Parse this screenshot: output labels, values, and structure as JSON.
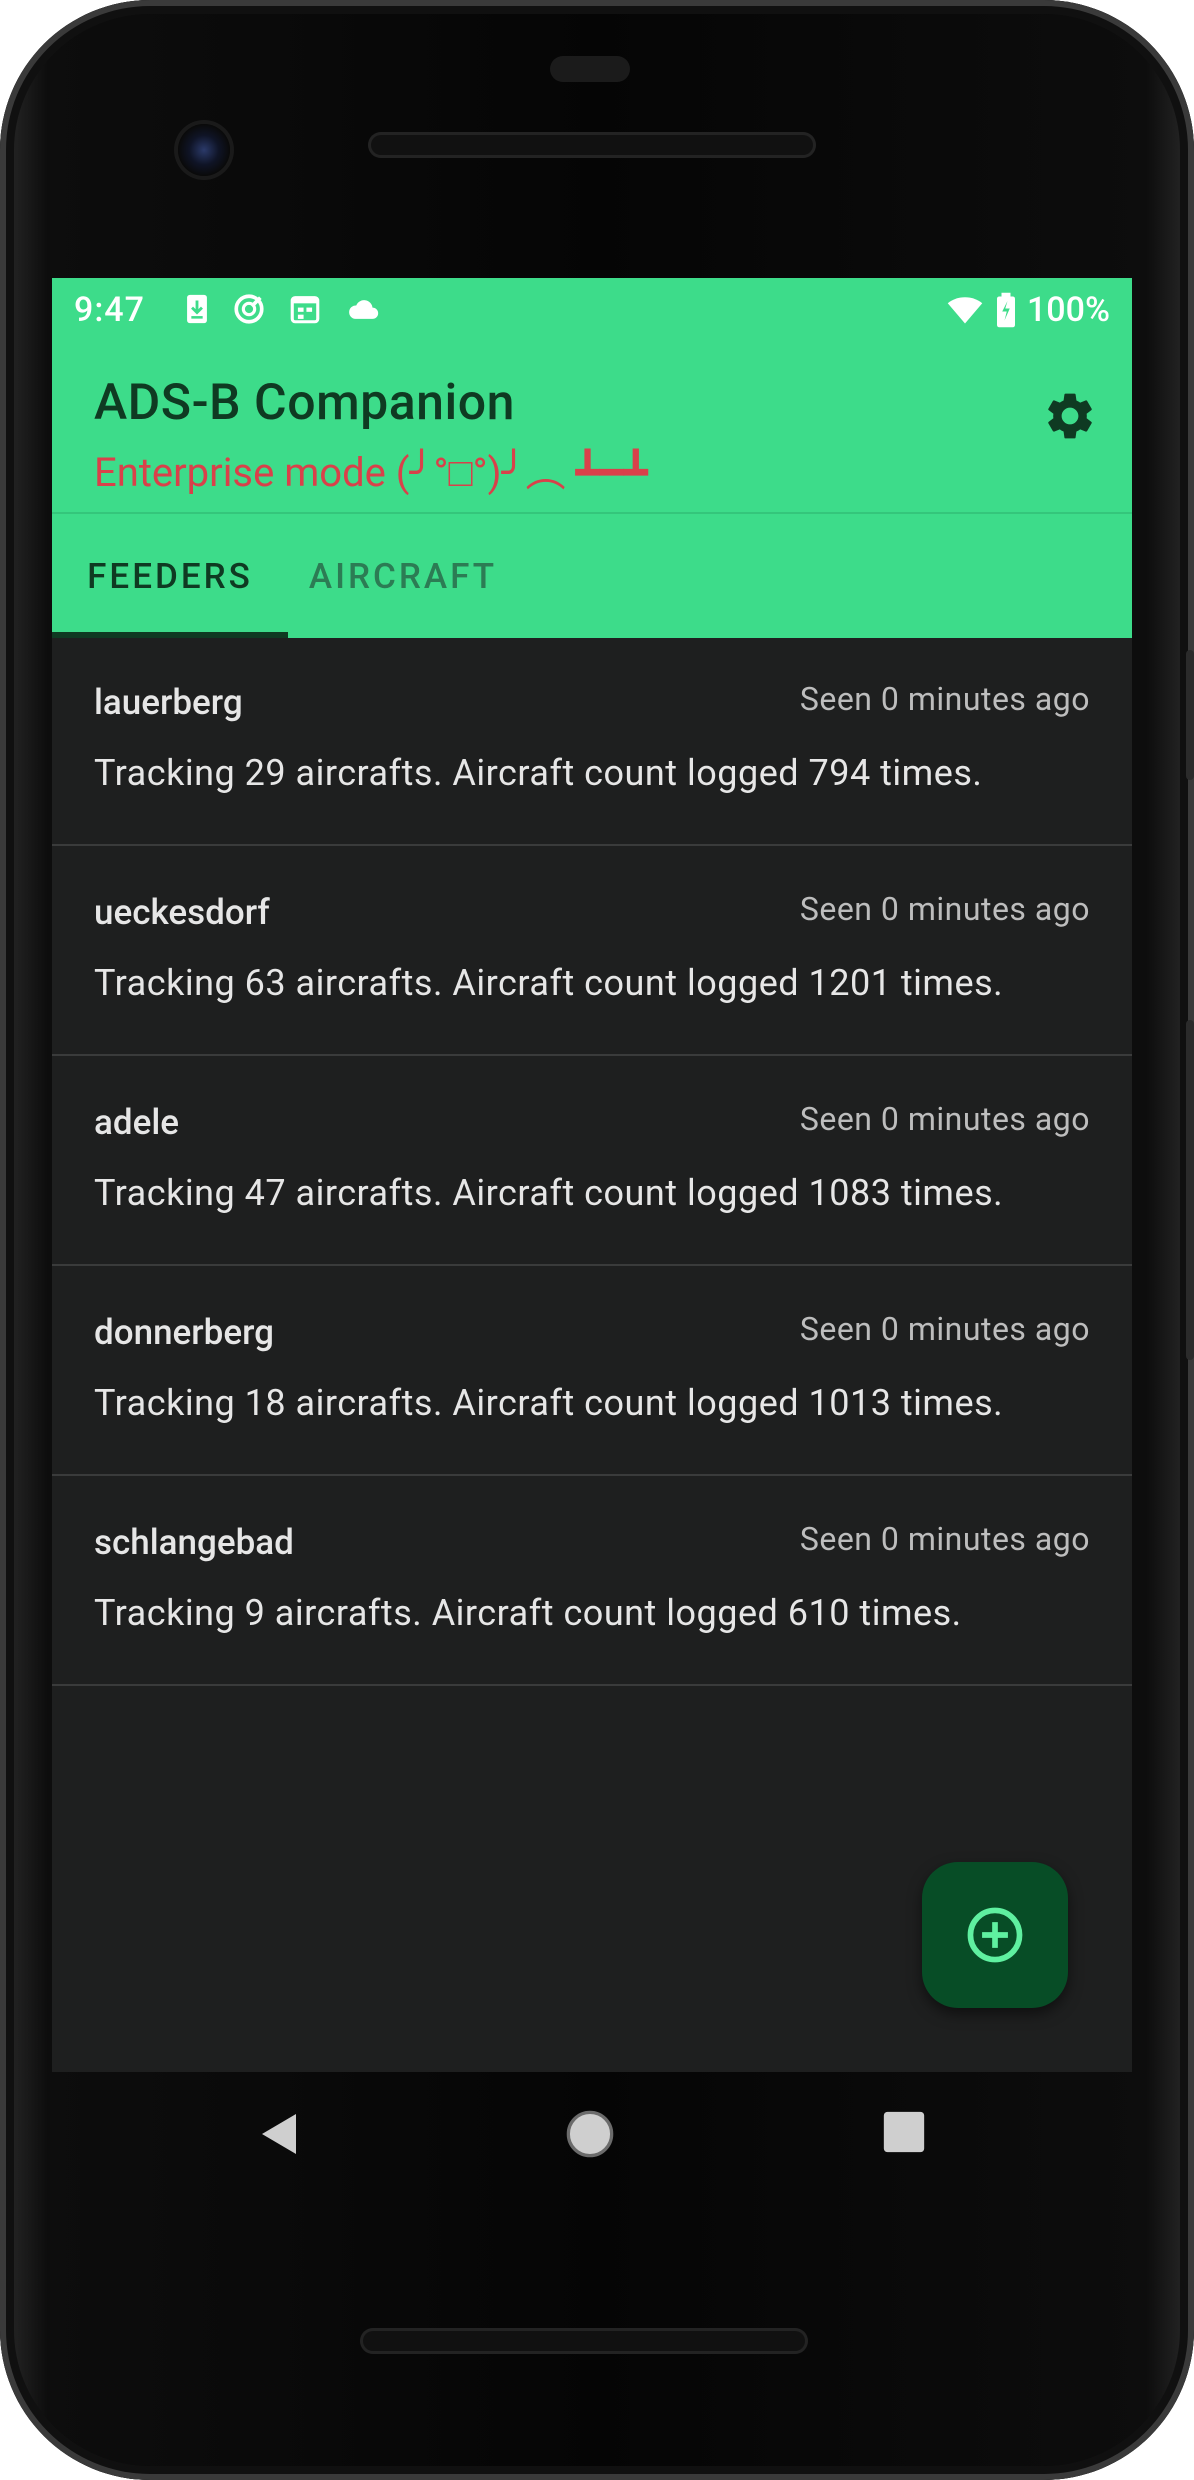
{
  "statusbar": {
    "time": "9:47",
    "icons_left": [
      "download-icon",
      "sync-icon",
      "calendar-icon",
      "cloud-icon"
    ],
    "icons_right": [
      "wifi-icon",
      "battery-icon"
    ],
    "battery": "100%"
  },
  "appbar": {
    "title": "ADS-B Companion",
    "subtitle": "Enterprise mode (╯°□°)╯︵ ┻━┻",
    "settings_icon": "gear-icon"
  },
  "tabs": [
    {
      "label": "FEEDERS",
      "selected": true
    },
    {
      "label": "AIRCRAFT",
      "selected": false
    }
  ],
  "feeders": [
    {
      "name": "lauerberg",
      "seen": "Seen 0 minutes ago",
      "detail": "Tracking 29 aircrafts. Aircraft count logged 794 times."
    },
    {
      "name": "ueckesdorf",
      "seen": "Seen 0 minutes ago",
      "detail": "Tracking 63 aircrafts. Aircraft count logged 1201 times."
    },
    {
      "name": "adele",
      "seen": "Seen 0 minutes ago",
      "detail": "Tracking 47 aircrafts. Aircraft count logged 1083 times."
    },
    {
      "name": "donnerberg",
      "seen": "Seen 0 minutes ago",
      "detail": "Tracking 18 aircrafts. Aircraft count logged 1013 times."
    },
    {
      "name": "schlangebad",
      "seen": "Seen 0 minutes ago",
      "detail": "Tracking 9 aircrafts. Aircraft count logged 610 times."
    }
  ],
  "fab": {
    "icon": "add-circle-icon"
  },
  "colors": {
    "accent": "#3ddc8a",
    "title": "#0f3a22",
    "subtitle": "#d9414a",
    "background": "#1e1f1f",
    "fab": "#074d26"
  },
  "navbar": {
    "icons": [
      "back-icon",
      "home-icon",
      "recents-icon"
    ]
  }
}
